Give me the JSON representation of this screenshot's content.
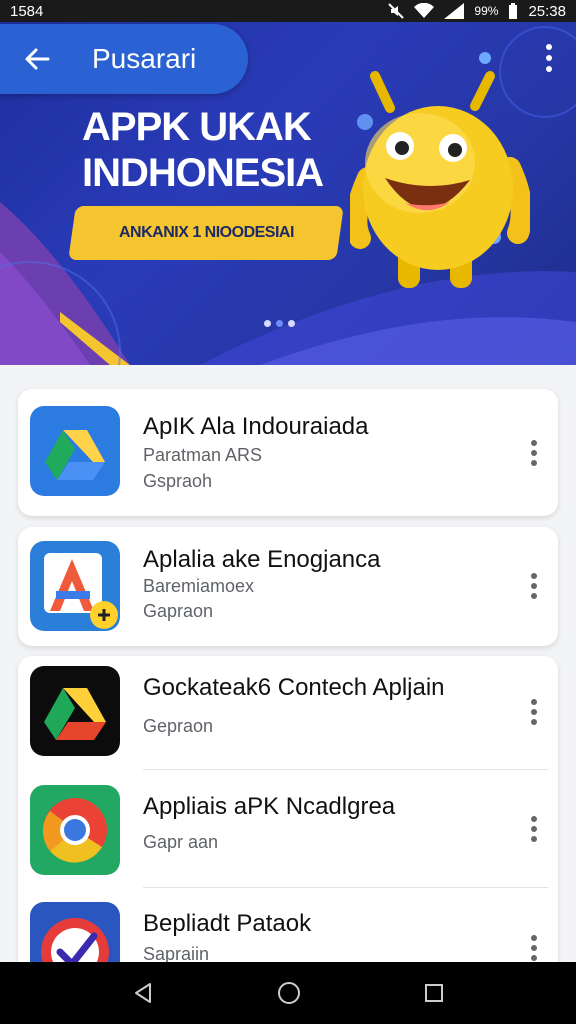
{
  "status": {
    "time_left": "1584",
    "battery": "99%",
    "time_right": "25:38"
  },
  "header": {
    "title": "Pusarari",
    "menu_icon": "more-vert-icon",
    "back_icon": "arrow-back-icon"
  },
  "banner": {
    "title_line1": "APPK UKAK",
    "title_line2": "INDHONESIA",
    "subtitle": "ANKANIX 1 NIOODESIAI",
    "page_count": 3,
    "active_page": 2,
    "colors": {
      "background": "#2a3bb8",
      "accent": "#f5c530",
      "pill": "#2a62d4"
    }
  },
  "apps": [
    {
      "name": "ApIK Ala Indouraiada",
      "line1": "Paratman ARS",
      "line2": "Gspraoh",
      "icon": "drive-triangle-icon"
    },
    {
      "name": "Aplalia ake Enogjanca",
      "line1": "Baremiamoex",
      "line2": "Gapraon",
      "icon": "letter-a-app-icon"
    },
    {
      "name": "Gockateak6 Contech Apljain",
      "line1": "",
      "line2": "Gepraon",
      "icon": "drive-dark-icon"
    },
    {
      "name": "Appliais aPK Ncadlgrea",
      "line1": "",
      "line2": "Gapr aan",
      "icon": "chrome-style-icon"
    },
    {
      "name": "Bepliadt Pataok",
      "line1": "",
      "line2": "Sapraiin",
      "icon": "red-check-app-icon"
    }
  ],
  "nav": {
    "back": "back-triangle-icon",
    "home": "home-circle-icon",
    "recents": "recents-square-icon"
  }
}
